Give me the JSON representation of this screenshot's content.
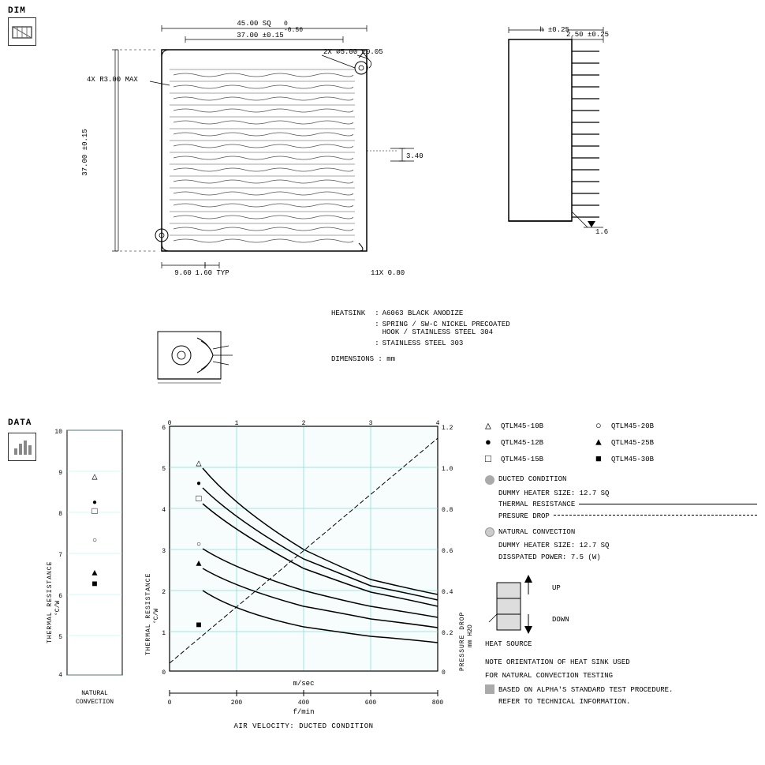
{
  "dim_label": "DIM",
  "data_label": "DATA",
  "dimensions_unit": "DIMENSIONS :  mm",
  "top_dim": {
    "sq_label": "45.00 SQ",
    "sq_tol": "0\n-0.50",
    "inner_dim": "37.00 ±0.15",
    "hole_label": "2X ⌀5.00 ±0.05",
    "corner_label": "4X R3.00 MAX",
    "side_dim": "37.00 ±0.15",
    "bottom_dims": "9.60",
    "typ_label": "1.60 TYP",
    "fin_label": "11X 0.80",
    "depth_label": "3.40"
  },
  "right_view": {
    "h_label": "h ±0.25",
    "dim1": "2.50 ±0.25",
    "dim2": "1.6"
  },
  "specs": {
    "heatsink_label": "HEATSINK",
    "spec1_label": "A6063  BLACK ANODIZE",
    "spec2_label": "SPRING / SW-C NICKEL PRECOATED",
    "spec2b_label": "HOOK / STAINLESS STEEL 304",
    "spec3_label": "STAINLESS STEEL 303"
  },
  "chart_left": {
    "y_label": "THERMAL RESISTANCE",
    "y_unit": "°C/W",
    "y_max": "10",
    "y_mid1": "9",
    "y_mid2": "8",
    "y_mid3": "7",
    "y_mid4": "6",
    "y_mid5": "5",
    "y_min": "4",
    "bottom_label1": "NATURAL",
    "bottom_label2": "CONVECTION"
  },
  "chart_main": {
    "title": "AIR VELOCITY:  DUCTED CONDITION",
    "y_label": "THERMAL RESISTANCE",
    "y_unit": "°C/W",
    "y_right_label": "PRESSURE DROP",
    "y_right_unit": "mm H2O",
    "x_label1": "m/sec",
    "x_label2": "f/min",
    "x_ticks_msec": [
      "0",
      "1",
      "2",
      "3",
      "4"
    ],
    "x_ticks_fmin": [
      "0",
      "200",
      "400",
      "600",
      "800"
    ],
    "y_ticks_left": [
      "0",
      "1",
      "2",
      "3",
      "4",
      "5",
      "6"
    ],
    "y_ticks_right": [
      "0",
      "0.2",
      "0.4",
      "0.6",
      "0.8",
      "1.0",
      "1.2"
    ]
  },
  "legend": {
    "items": [
      {
        "symbol": "△",
        "label": "QTLM45-10B",
        "symbol2": "○",
        "label2": "QTLM45-20B"
      },
      {
        "symbol": "●",
        "label": "QTLM45-12B",
        "symbol2": "▲",
        "label2": "QTLM45-25B"
      },
      {
        "symbol": "□",
        "label": "QTLM45-15B",
        "symbol2": "■",
        "label2": "QTLM45-30B"
      }
    ],
    "ducted_label": "DUCTED CONDITION",
    "ducted_heater": "DUMMY HEATER SIZE: 12.7 SQ",
    "ducted_thermal": "THERMAL RESISTANCE",
    "ducted_pressure": "PRESURE DROP",
    "natural_label": "NATURAL CONVECTION",
    "natural_heater": "DUMMY HEATER SIZE: 12.7 SQ",
    "natural_power": "DISSPATED POWER: 7.5 (W)",
    "note1": "NOTE ORIENTATION OF HEAT SINK USED",
    "note2": "FOR NATURAL CONVECTION TESTING",
    "note3": "BASED ON ALPHA'S STANDARD TEST PROCEDURE.",
    "note4": "REFER TO TECHNICAL INFORMATION.",
    "up_label": "UP",
    "down_label": "DOWN",
    "heat_source_label": "HEAT SOURCE"
  }
}
